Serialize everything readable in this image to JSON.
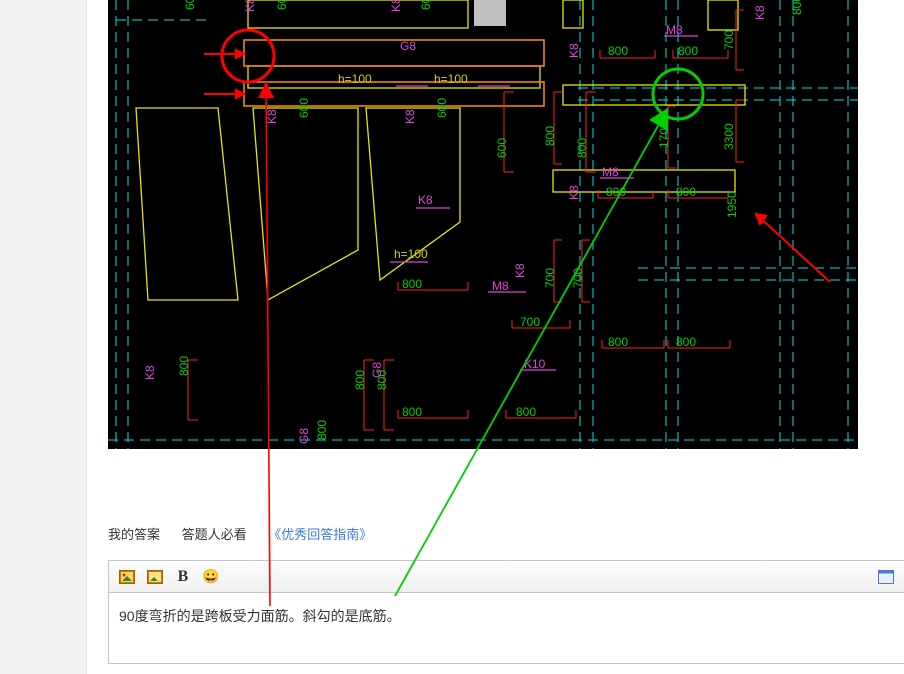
{
  "answer_section": {
    "my_answer": "我的答案",
    "must_read": "答题人必看",
    "guide_link": "《优秀回答指南》"
  },
  "toolbar": {
    "image_btn": "插入图片",
    "image2_btn": "插入图片2",
    "bold_label": "B",
    "emoji_label": "😀",
    "fullscreen_btn": "全屏"
  },
  "editor": {
    "content": "90度弯折的是跨板受力面筋。斜勾的是底筋。"
  },
  "cad": {
    "labels": {
      "g8": "G8",
      "k8": "K8",
      "m8": "M8",
      "k10": "K10",
      "h100": "h=100",
      "d600": "600",
      "d700": "700",
      "d800": "800",
      "d1700": "1700",
      "d3300": "3300",
      "d1950": "1950"
    }
  }
}
